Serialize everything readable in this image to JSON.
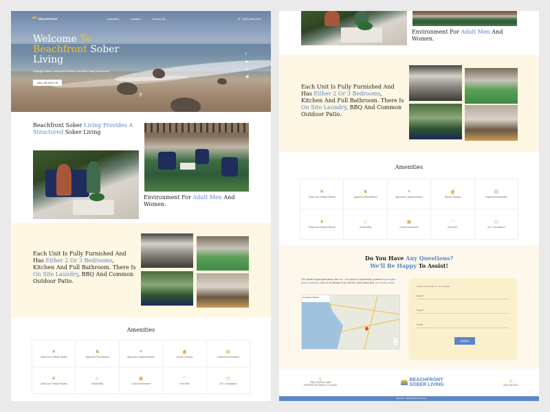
{
  "brand": {
    "name": "BEACHFRONT",
    "name2": "SOBER LIVING",
    "nav_logo": "BEACHFRONT"
  },
  "nav": {
    "links": [
      "Amenities",
      "Location",
      "Contact Us"
    ],
    "phone": "(949) 438-9031"
  },
  "hero": {
    "title_1": "Welcome",
    "title_2": "To",
    "title_3": "Beachfront",
    "title_4": "Sober Living",
    "subtitle": "Huntington Beach, California's Premier Coed Sober Living Environment",
    "cta": "CALL OR TEXT US",
    "social": [
      "f",
      "▶",
      "◎",
      "▣"
    ]
  },
  "intro": {
    "h_a": "Beachfront Sober ",
    "h_b": "Living Provides A Structured",
    "h_c": " Sober Living",
    "tail_a": "Environment For ",
    "tail_b": "Adult Men",
    "tail_c": " And Women."
  },
  "units": {
    "a": "Each Unit Is Fully Furnished And Has ",
    "b": "Either 2 Or 3 Bedrooms",
    "c": ", Kitchen And Full Bathroom. There Is ",
    "d": "On Site Laundry",
    "e": ", BBQ And Common Outdoor Patio."
  },
  "amenities": {
    "title": "Amenities",
    "items": [
      {
        "label": "Clean And Freshly Painted",
        "icon": "laurel-icon"
      },
      {
        "label": "Approved Pets Allowed",
        "icon": "dog-icon"
      },
      {
        "label": "Approved Couples Allowed",
        "icon": "couple-icon"
      },
      {
        "label": "Secure Campus",
        "icon": "thumb-icon"
      },
      {
        "label": "Peaceful Environment",
        "icon": "book-icon"
      },
      {
        "label": "Clean And Freshly Painted",
        "icon": "laurel-icon"
      },
      {
        "label": "Onsite BBQ",
        "icon": "grill-icon"
      },
      {
        "label": "Covid Environment",
        "icon": "box-icon"
      },
      {
        "label": "Free WiFi",
        "icon": "wifi-icon"
      },
      {
        "label": "24/7 Consultation",
        "icon": "clock-icon"
      }
    ]
  },
  "questions": {
    "t1": "Do You Have ",
    "t2": "Any Questions?",
    "t3": "We'll Be Happy",
    "t4": " To Assist!",
    "body_a": "The Garden Style Apartments Has ",
    "body_b": "Four Units",
    "body_c": " And Is Conveniently Located In ",
    "body_d": "Huntington Beach California",
    "body_e": ". Just 10-15 Minutes From HB Pier, Main Street And ",
    "body_f": "The Pacific Ocean",
    "body_g": "."
  },
  "map": {
    "label": "Huntington Beach",
    "zoom_in": "+",
    "zoom_out": "−"
  },
  "form": {
    "note": "Fields marked with an * are required",
    "name": "Name*",
    "phone": "Phone*",
    "email": "Email*",
    "submit": "SUBMIT"
  },
  "footer": {
    "address_1": "7082 CHURCH LANE",
    "address_2": "HUNTINGTON BEACH, CA 92647",
    "phone": "(949) 438-9031",
    "copyright": "Copyright © 2023 All Rights Reserved"
  },
  "colors": {
    "accent_blue": "#5b86c9",
    "accent_yellow": "#f2c12e",
    "cream": "#fdf7e3"
  }
}
